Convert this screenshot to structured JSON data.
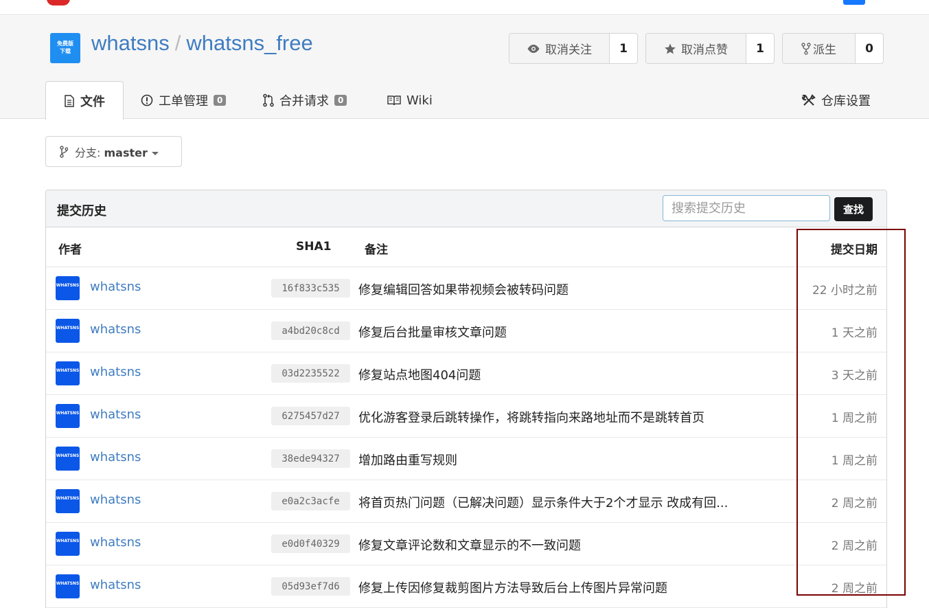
{
  "repo": {
    "owner": "whatsns",
    "separator": "/",
    "name": "whatsns_free",
    "avatar_text_1": "免费版",
    "avatar_text_2": "下载"
  },
  "actions": {
    "watch": {
      "label": "取消关注",
      "count": "1"
    },
    "star": {
      "label": "取消点赞",
      "count": "1"
    },
    "fork": {
      "label": "派生",
      "count": "0"
    }
  },
  "tabs": {
    "files": "文件",
    "issues": "工单管理",
    "issues_count": "0",
    "pulls": "合并请求",
    "pulls_count": "0",
    "wiki": "Wiki",
    "settings": "仓库设置"
  },
  "branch": {
    "label": "分支:",
    "value": "master"
  },
  "history": {
    "title": "提交历史",
    "search_placeholder": "搜索提交历史",
    "search_button": "查找",
    "columns": {
      "author": "作者",
      "sha": "SHA1",
      "message": "备注",
      "date": "提交日期"
    },
    "avatar_text": "WHATSNS",
    "commits": [
      {
        "author": "whatsns",
        "sha": "16f833c535",
        "message": "修复编辑回答如果带视频会被转码问题",
        "date": "22 小时之前"
      },
      {
        "author": "whatsns",
        "sha": "a4bd20c8cd",
        "message": "修复后台批量审核文章问题",
        "date": "1 天之前"
      },
      {
        "author": "whatsns",
        "sha": "03d2235522",
        "message": "修复站点地图404问题",
        "date": "3 天之前"
      },
      {
        "author": "whatsns",
        "sha": "6275457d27",
        "message": "优化游客登录后跳转操作，将跳转指向来路地址而不是跳转首页",
        "date": "1 周之前"
      },
      {
        "author": "whatsns",
        "sha": "38ede94327",
        "message": "增加路由重写规则",
        "date": "1 周之前"
      },
      {
        "author": "whatsns",
        "sha": "e0a2c3acfe",
        "message": "将首页热门问题（已解决问题）显示条件大于2个才显示 改成有回...",
        "date": "2 周之前"
      },
      {
        "author": "whatsns",
        "sha": "e0d0f40329",
        "message": "修复文章评论数和文章显示的不一致问题",
        "date": "2 周之前"
      },
      {
        "author": "whatsns",
        "sha": "05d93ef7d6",
        "message": "修复上传因修复裁剪图片方法导致后台上传图片异常问题",
        "date": "2 周之前"
      }
    ]
  },
  "colors": {
    "link": "#3f7cc1",
    "highlight_border": "#7b0000",
    "avatar": "#0b57e8"
  }
}
